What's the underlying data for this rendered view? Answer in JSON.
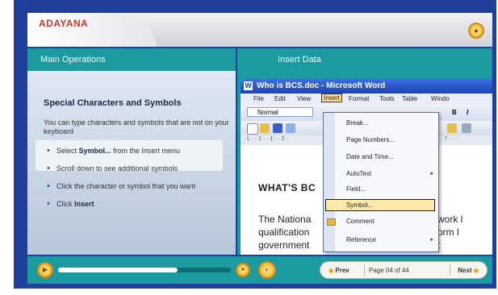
{
  "brand": {
    "logo": "ADAYANA"
  },
  "colors": {
    "teal": "#1b9a9f",
    "navy": "#1f3f9a",
    "accent_gold": "#e0a722"
  },
  "left": {
    "header": "Main Operations",
    "title": "Special Characters and Symbols",
    "intro": "You can type characters and symbols that are not on your keyboard",
    "steps": [
      {
        "pre": "Select ",
        "bold": "Symbol...",
        "post": " from the Insert menu"
      },
      {
        "pre": "Scroll down to see additional symbols",
        "bold": "",
        "post": ""
      },
      {
        "pre": "Click the character or symbol that you want",
        "bold": "",
        "post": ""
      },
      {
        "pre": "Click ",
        "bold": "Insert",
        "post": ""
      }
    ]
  },
  "right": {
    "header": "Insert Data",
    "word": {
      "title": "Who is BCS.doc - Microsoft Word",
      "menu": [
        "File",
        "Edit",
        "View",
        "Insert",
        "Format",
        "Tools",
        "Table",
        "Windo"
      ],
      "style_box": "Normal",
      "heading": "WHAT'S BC",
      "body_lines": [
        "The Nationa",
        "qualification",
        "government"
      ],
      "right_lines": [
        "work l",
        "orm l",
        "t"
      ],
      "insert_menu": [
        "Break...",
        "Page Numbers...",
        "Date and Time...",
        "AutoText",
        "Field...",
        "Symbol...",
        "Comment",
        "Reference"
      ],
      "selected_item": "Symbol..."
    }
  },
  "footer": {
    "progress_fraction": 0.69,
    "prev_label": "Prev",
    "page_label": "Page 04 of 44",
    "next_label": "Next"
  }
}
